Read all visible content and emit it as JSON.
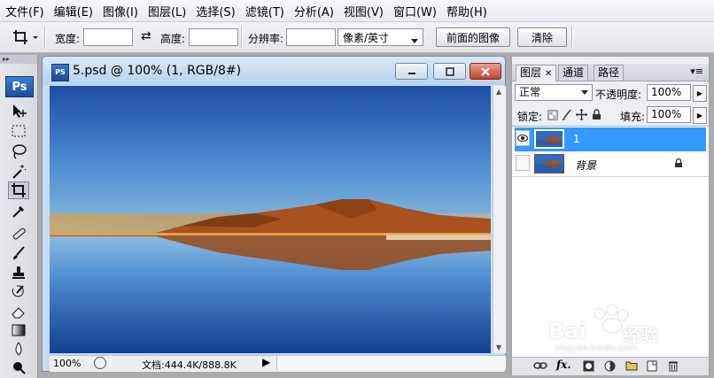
{
  "menu": [
    "文件(F)",
    "编辑(E)",
    "图像(I)",
    "图层(L)",
    "选择(S)",
    "滤镜(T)",
    "分析(A)",
    "视图(V)",
    "窗口(W)",
    "帮助(H)"
  ],
  "options": {
    "width_label": "宽度:",
    "height_label": "高度:",
    "swap_symbol": "⇄",
    "resolution_label": "分辨率:",
    "unit_value": "像素/英寸",
    "front_image_label": "前面的图像",
    "clear_label": "清除"
  },
  "toolbox": {
    "logo": "Ps"
  },
  "document": {
    "title": "5.psd @ 100% (1, RGB/8#)",
    "icon_text": "PS",
    "zoom": "100%",
    "doc_info": "文档:444.4K/888.8K"
  },
  "layers_panel": {
    "tabs": [
      "图层",
      "通道",
      "路径"
    ],
    "blend_mode": "正常",
    "opacity_label": "不透明度:",
    "opacity_value": "100%",
    "lock_label": "锁定:",
    "fill_label": "填充:",
    "fill_value": "100%",
    "layers": [
      {
        "name": "1",
        "selected": true,
        "visible": true
      },
      {
        "name": "背景",
        "selected": false,
        "visible": false,
        "locked": true
      }
    ]
  },
  "watermark": {
    "text": "Bai",
    "text2": "经验",
    "url": "jingyan.baidu.com"
  },
  "colors": {
    "selected_layer": "#3399ff",
    "ps_blue": "#1c4f99"
  }
}
